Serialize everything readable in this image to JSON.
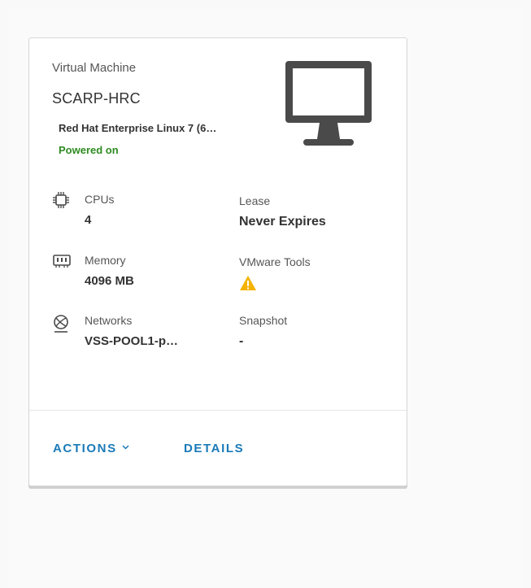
{
  "vm": {
    "type_label": "Virtual Machine",
    "name": "SCARP-HRC",
    "os": "Red Hat Enterprise Linux 7 (6…",
    "power_state": "Powered on"
  },
  "specs": {
    "cpus": {
      "label": "CPUs",
      "value": "4",
      "icon": "cpu-icon"
    },
    "memory": {
      "label": "Memory",
      "value": "4096 MB",
      "icon": "memory-icon"
    },
    "networks": {
      "label": "Networks",
      "value": "VSS-POOL1-p…",
      "icon": "network-icon"
    },
    "lease": {
      "label": "Lease",
      "value": "Never Expires"
    },
    "vmware_tools": {
      "label": "VMware Tools",
      "icon": "warning-icon"
    },
    "snapshot": {
      "label": "Snapshot",
      "value": "-"
    }
  },
  "actions": {
    "actions_label": "ACTIONS",
    "details_label": "DETAILS"
  },
  "colors": {
    "accent": "#1a7ab8",
    "powered_on": "#2e8b21",
    "warning": "#f5b301",
    "icon_dark": "#4a4a4a"
  }
}
